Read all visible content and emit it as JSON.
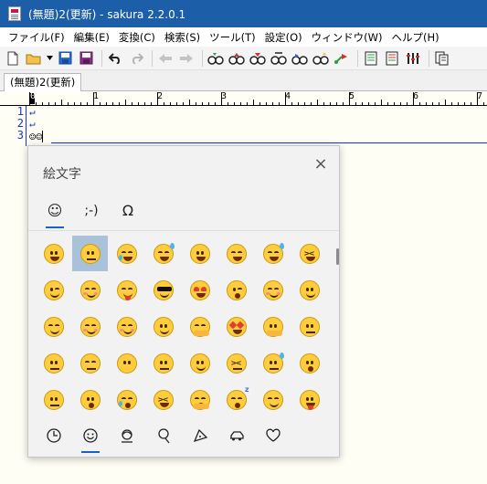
{
  "window": {
    "title": "(無題)2(更新) - sakura 2.2.0.1"
  },
  "menu": [
    "ファイル(F)",
    "編集(E)",
    "変換(C)",
    "検索(S)",
    "ツール(T)",
    "設定(O)",
    "ウィンドウ(W)",
    "ヘルプ(H)"
  ],
  "toolbar": {
    "icons": [
      "new-file-icon",
      "open-folder-icon",
      "save-icon",
      "save-all-icon",
      "undo-icon",
      "redo-icon",
      "back-icon",
      "forward-icon",
      "search-icon",
      "search-up-icon",
      "search-down-icon",
      "replace-icon",
      "find-next-icon",
      "bookmark-icon",
      "jump-icon",
      "print-icon",
      "print-preview-icon",
      "compare-icon",
      "grep-icon"
    ]
  },
  "tab": {
    "label": "(無題)2(更新)"
  },
  "ruler": {
    "marks": [
      "0",
      "1",
      "2",
      "3",
      "4",
      "5",
      "6",
      "7"
    ]
  },
  "editor": {
    "line_numbers": [
      "1",
      "2",
      "3"
    ],
    "lines": [
      "↵",
      "↵",
      "☺☺"
    ],
    "eol_marker": "↵"
  },
  "emoji_panel": {
    "title": "絵文字",
    "close": "×",
    "tabs": [
      {
        "label": "☺",
        "name": "emoji-tab"
      },
      {
        "label": ";-)",
        "name": "kaomoji-tab"
      },
      {
        "label": "Ω",
        "name": "symbols-tab"
      }
    ],
    "active_tab": 0,
    "selected_cell": 1,
    "emojis": [
      "grinning",
      "grimacing",
      "joy",
      "rofl",
      "grin",
      "smile",
      "sweat-smile",
      "laughing",
      "wink",
      "blush",
      "yum",
      "sunglasses",
      "heart-eyes",
      "kissing-heart",
      "smiling-hearts",
      "slightly-smiling",
      "smiling-closed",
      "blush-eyes",
      "relaxed",
      "slight-smile",
      "hugging",
      "star-struck",
      "thinking",
      "raised-eyebrow",
      "neutral",
      "expressionless",
      "no-mouth",
      "rolling-eyes",
      "smirk",
      "persevere",
      "disappointed-relieved",
      "open-mouth",
      "zipper",
      "hushed",
      "sleepy",
      "tired",
      "yawning",
      "sleeping",
      "relieved",
      "tongue"
    ],
    "categories": [
      {
        "name": "recent",
        "icon": "clock-icon"
      },
      {
        "name": "smileys",
        "icon": "smiley-icon"
      },
      {
        "name": "people",
        "icon": "person-icon"
      },
      {
        "name": "nature",
        "icon": "leaf-icon"
      },
      {
        "name": "food",
        "icon": "pizza-icon"
      },
      {
        "name": "travel",
        "icon": "car-icon"
      },
      {
        "name": "symbols",
        "icon": "heart-icon"
      }
    ],
    "active_category": 1
  }
}
